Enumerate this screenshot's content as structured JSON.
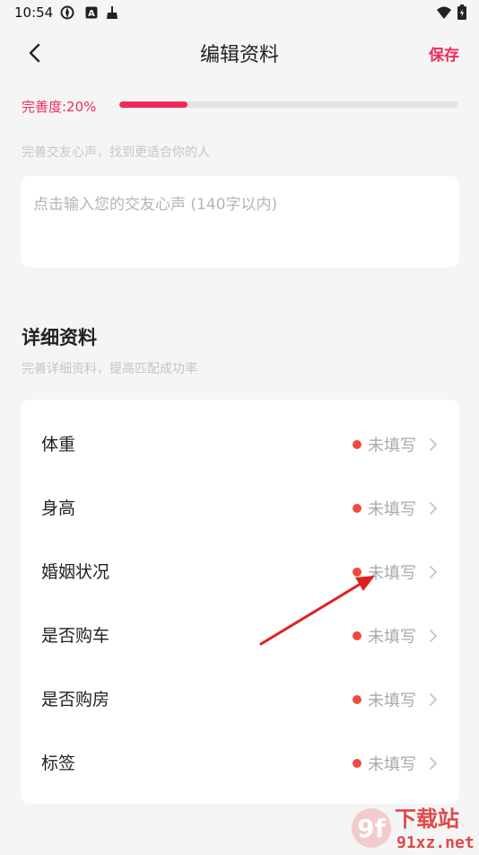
{
  "status_bar": {
    "time": "10:54",
    "icons": [
      "settings-sync-icon",
      "a-box-icon",
      "broom-icon",
      "wifi-icon",
      "battery-icon"
    ]
  },
  "header": {
    "title": "编辑资料",
    "save_label": "保存",
    "back_icon": "chevron-left-icon"
  },
  "completion": {
    "label": "完善度:20%",
    "percent": 20
  },
  "motto": {
    "hint": "完善交友心声，找到更适合你的人",
    "placeholder": "点击输入您的交友心声 (140字以内)",
    "value": ""
  },
  "details": {
    "title": "详细资料",
    "subtitle": "完善详细资料，提高匹配成功率",
    "items": [
      {
        "label": "体重",
        "status": "未填写"
      },
      {
        "label": "身高",
        "status": "未填写"
      },
      {
        "label": "婚姻状况",
        "status": "未填写"
      },
      {
        "label": "是否购车",
        "status": "未填写"
      },
      {
        "label": "是否购房",
        "status": "未填写"
      },
      {
        "label": "标签",
        "status": "未填写"
      }
    ]
  },
  "colors": {
    "accent": "#ee2a5a",
    "dot": "#f04a40",
    "annotation_arrow": "#e02020"
  },
  "watermark": {
    "logo_text": "9f 下载站 91xz.net"
  }
}
